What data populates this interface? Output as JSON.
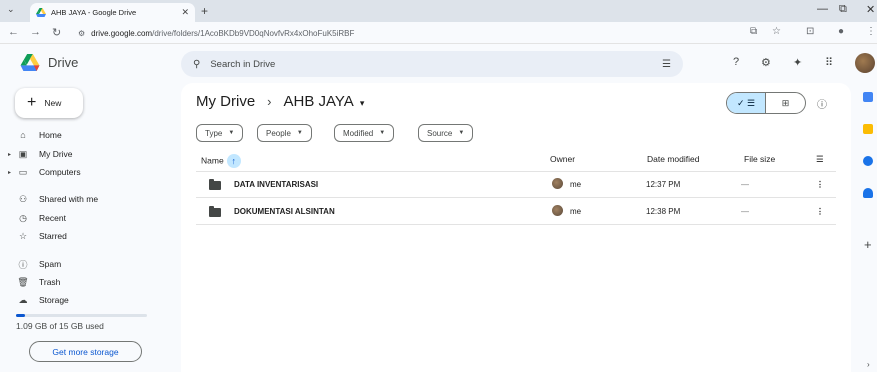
{
  "browser": {
    "tab_title": "AHB JAYA - Google Drive",
    "url_prefix": "drive.google.com",
    "url_path": "/drive/folders/1AcoBKDb9VD0qNovfvRx4xOhoFuK5iRBF"
  },
  "header": {
    "app_name": "Drive",
    "search_placeholder": "Search in Drive"
  },
  "sidebar": {
    "new_label": "New",
    "items": [
      {
        "label": "Home",
        "icon": "home-icon"
      },
      {
        "label": "My Drive",
        "icon": "my-drive-icon"
      },
      {
        "label": "Computers",
        "icon": "computer-icon"
      },
      {
        "label": "Shared with me",
        "icon": "people-icon"
      },
      {
        "label": "Recent",
        "icon": "clock-icon"
      },
      {
        "label": "Starred",
        "icon": "star-icon"
      },
      {
        "label": "Spam",
        "icon": "spam-icon"
      },
      {
        "label": "Trash",
        "icon": "trash-icon"
      },
      {
        "label": "Storage",
        "icon": "cloud-icon"
      }
    ],
    "storage_used_fraction": 0.07,
    "storage_text": "1.09 GB of 15 GB used",
    "get_storage_label": "Get more storage"
  },
  "main": {
    "breadcrumb_root": "My Drive",
    "breadcrumb_current": "AHB JAYA",
    "filters": [
      "Type",
      "People",
      "Modified",
      "Source"
    ],
    "columns": {
      "name": "Name",
      "owner": "Owner",
      "modified": "Date modified",
      "size": "File size"
    },
    "rows": [
      {
        "name": "DATA INVENTARISASI",
        "owner": "me",
        "modified": "12:37 PM",
        "size": "—"
      },
      {
        "name": "DOKUMENTASI ALSINTAN",
        "owner": "me",
        "modified": "12:38 PM",
        "size": "—"
      }
    ]
  },
  "colors": {
    "accent": "#0b57d0",
    "selected": "#c2e7ff"
  }
}
